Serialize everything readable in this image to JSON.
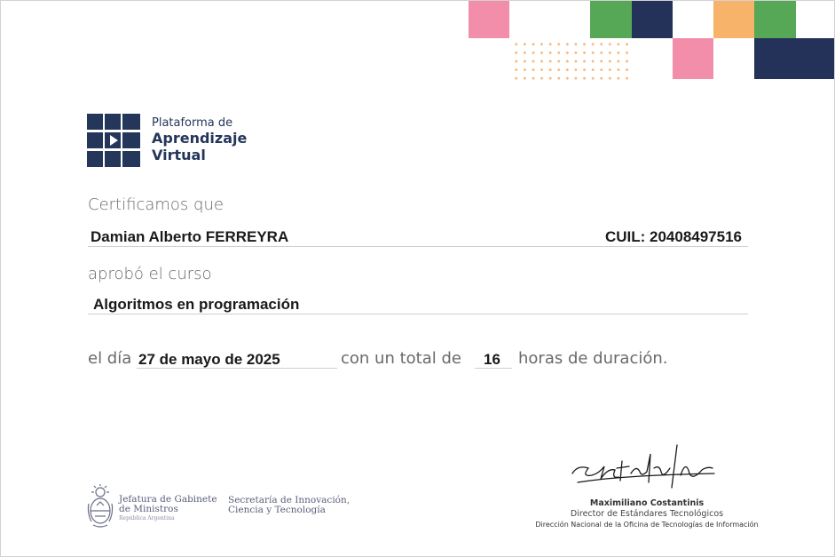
{
  "brand": {
    "line1": "Plataforma de",
    "line2": "Aprendizaje",
    "line3": "Virtual",
    "color": "#24365a",
    "icon": "video-play-grid-icon"
  },
  "palette": {
    "pink": "#f28daa",
    "green": "#56a756",
    "navy": "#24325a",
    "orange": "#f7b36a",
    "dots": "#f6b780"
  },
  "certificate": {
    "intro": "Certificamos que",
    "name": "Damian Alberto FERREYRA",
    "cuil": "CUIL: 20408497516",
    "approved": "aprobó el curso",
    "course": "Algoritmos en programación",
    "on_day": "el día",
    "date": "27 de mayo de 2025",
    "with_total": "con un total de",
    "hours": "16",
    "hours_suffix": "horas de duración."
  },
  "footer": {
    "org1_line1": "Jefatura de Gabinete",
    "org1_line2": "de Ministros",
    "org1_sub": "República Argentina",
    "org2_line1": "Secretaría de Innovación,",
    "org2_line2": "Ciencia y Tecnología",
    "signer_name": "Maximiliano Costantinis",
    "signer_role": "Director de Estándares Tecnológicos",
    "signer_org": "Dirección Nacional de la Oficina de Tecnologías de Información"
  }
}
